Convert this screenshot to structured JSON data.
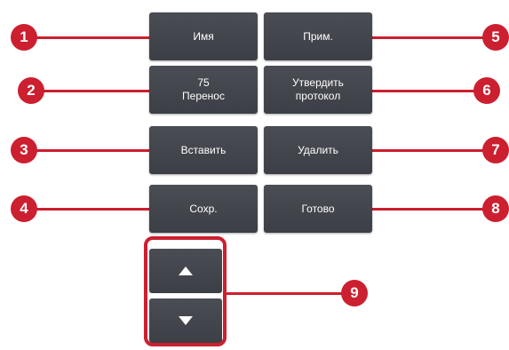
{
  "buttons": {
    "name": "Имя",
    "transfer_count": "75",
    "transfer": "Перенос",
    "insert": "Вставить",
    "save": "Сохр.",
    "note": "Прим.",
    "approve_line1": "Утвердить",
    "approve_line2": "протокол",
    "delete": "Удалить",
    "done": "Готово"
  },
  "markers": {
    "m1": "1",
    "m2": "2",
    "m3": "3",
    "m4": "4",
    "m5": "5",
    "m6": "6",
    "m7": "7",
    "m8": "8",
    "m9": "9"
  },
  "icons": {
    "up": "triangle-up",
    "down": "triangle-down"
  },
  "colors": {
    "button": "#43464d",
    "callout": "#cc1f2f",
    "text": "#ffffff"
  }
}
